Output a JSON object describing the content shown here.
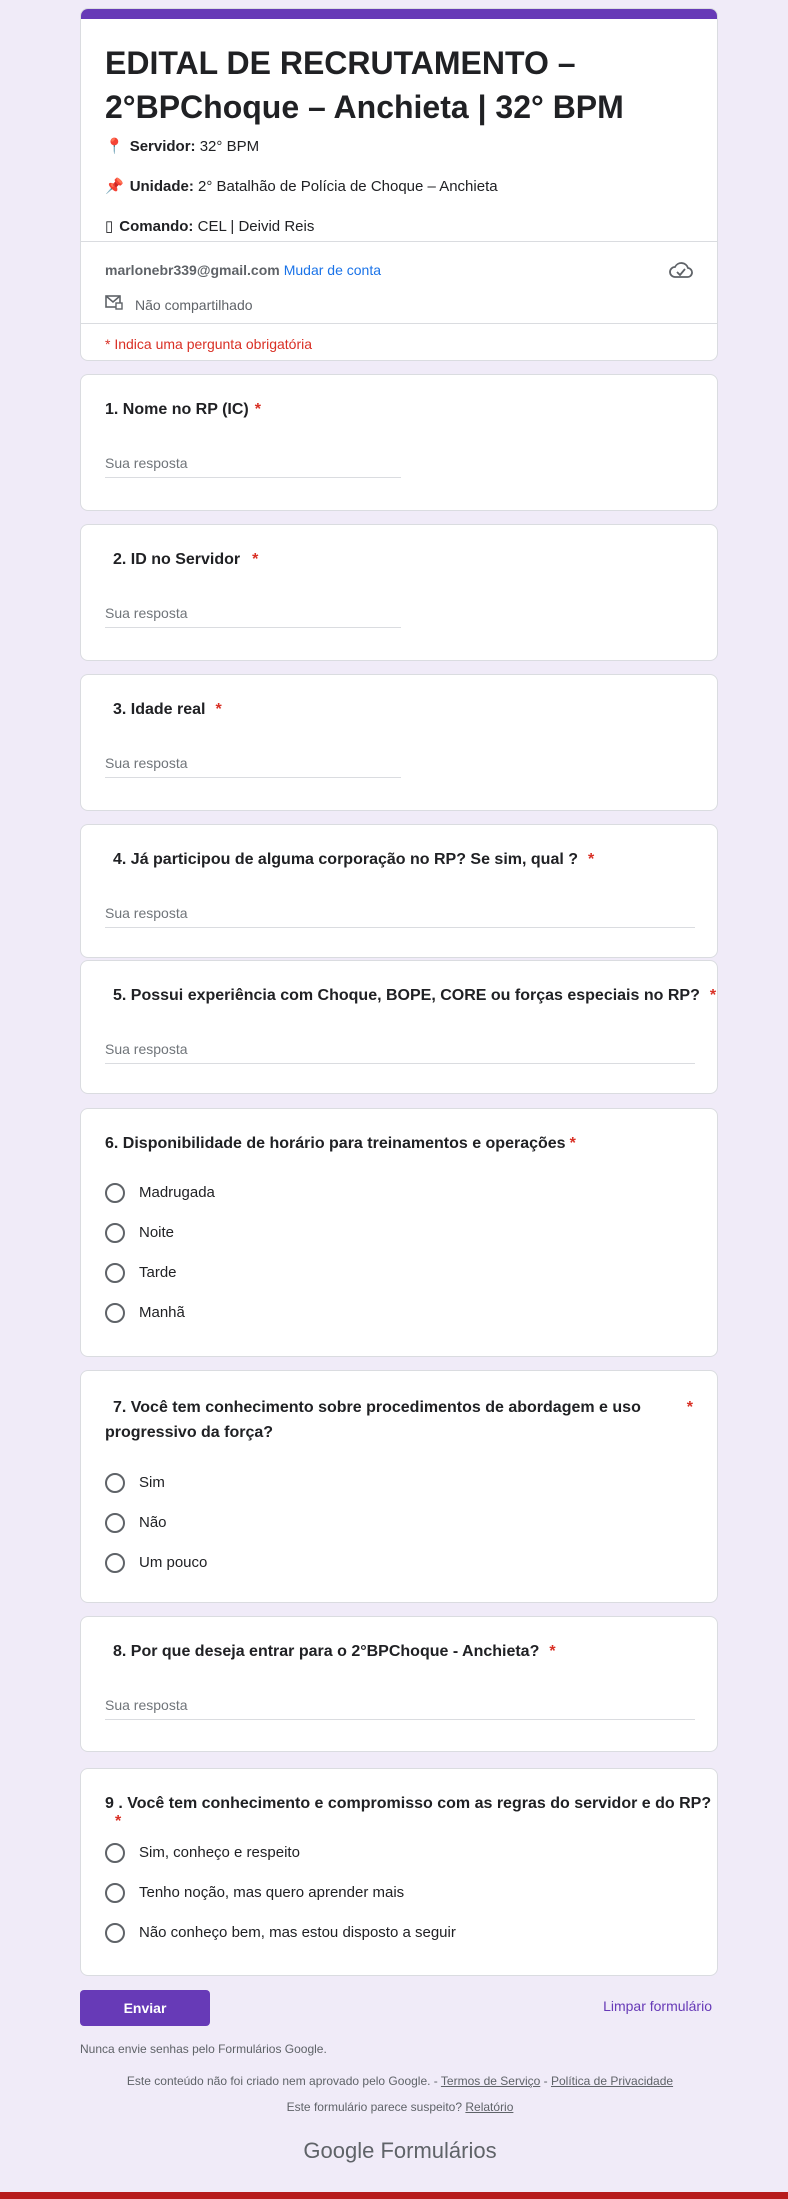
{
  "header": {
    "title": "EDITAL DE RECRUTAMENTO – 2°BPChoque – Anchieta | 32° BPM",
    "lines": [
      {
        "icon": "📍",
        "label": "Servidor:",
        "value": "32° BPM"
      },
      {
        "icon": "📌",
        "label": "Unidade:",
        "value": "2° Batalhão de Polícia de Choque – Anchieta"
      },
      {
        "icon": "▯",
        "label": "Comando:",
        "value": "CEL | Deivid Reis"
      }
    ],
    "account_email": "marlonebr339@gmail.com",
    "switch_account": "Mudar de conta",
    "not_shared": "Não compartilhado",
    "required_notice": "* Indica uma pergunta obrigatória"
  },
  "questions": [
    {
      "title": "1. Nome no RP (IC)",
      "star": "*",
      "placeholder": "Sua resposta"
    },
    {
      "title": "2. ID no Servidor",
      "star": "*",
      "placeholder": "Sua resposta"
    },
    {
      "title": "3. Idade real",
      "star": "*",
      "placeholder": "Sua resposta"
    },
    {
      "title": "4. Já participou de alguma corporação no RP? Se sim, qual ?",
      "star": "*",
      "placeholder": "Sua resposta"
    },
    {
      "title": "5. Possui experiência com Choque, BOPE, CORE ou forças especiais no RP?",
      "star": "*",
      "placeholder": "Sua resposta"
    },
    {
      "title": "6. Disponibilidade de horário para treinamentos e operações",
      "star": "*",
      "options": [
        "Madrugada",
        "Noite",
        "Tarde",
        "Manhã"
      ]
    },
    {
      "title_line1": "7. Você tem conhecimento sobre procedimentos de abordagem e uso",
      "title_line2": "progressivo da força?",
      "star": "*",
      "options": [
        "Sim",
        "Não",
        "Um pouco"
      ]
    },
    {
      "title": "8. Por que deseja entrar para o 2°BPChoque - Anchieta?",
      "star": "*",
      "placeholder": "Sua resposta"
    },
    {
      "title": "9 . Você tem conhecimento e compromisso com as regras do servidor e do RP?",
      "star": "*",
      "options": [
        "Sim, conheço e respeito",
        "Tenho noção, mas quero aprender mais",
        "Não conheço bem, mas estou disposto a seguir"
      ]
    }
  ],
  "actions": {
    "submit": "Enviar",
    "clear": "Limpar formulário"
  },
  "footer": {
    "note": "Nunca envie senhas pelo Formulários Google.",
    "legal_prefix": "Este conteúdo não foi criado nem aprovado pelo Google. -",
    "terms": "Termos de Serviço",
    "separator": "-",
    "privacy": "Política de Privacidade",
    "suspicious": "Este formulário parece suspeito?",
    "report": "Relatório",
    "brand_google": "Google",
    "brand_forms": "Formulários"
  },
  "colors": {
    "accent": "#673ab7",
    "background": "#f0ebf8",
    "required": "#d93025",
    "link": "#1a73e8"
  }
}
